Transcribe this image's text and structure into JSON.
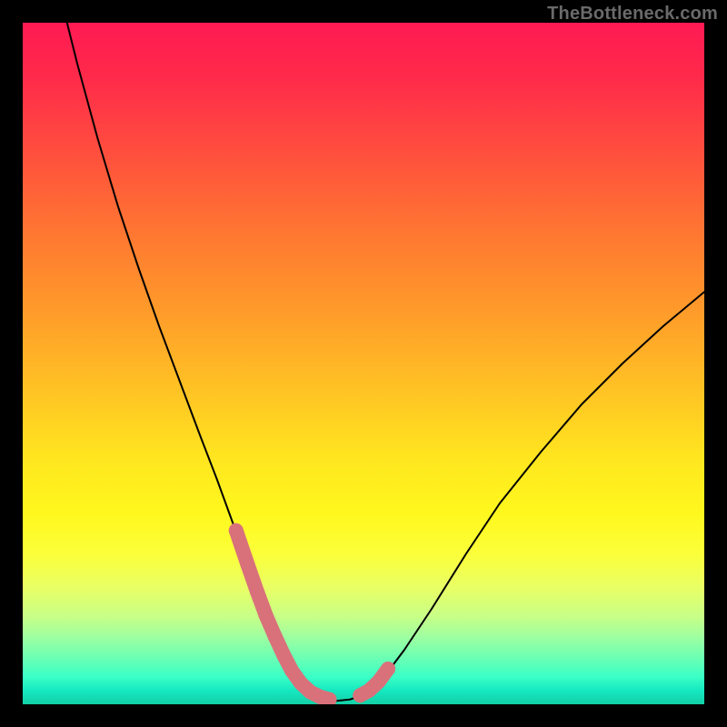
{
  "watermark": {
    "text": "TheBottleneck.com"
  },
  "chart_data": {
    "type": "line",
    "title": "",
    "xlabel": "",
    "ylabel": "",
    "xlim": [
      0,
      100
    ],
    "ylim": [
      0,
      100
    ],
    "grid": false,
    "legend": false,
    "annotations": [],
    "series": [
      {
        "name": "left-curve",
        "color": "#000000",
        "x": [
          6.5,
          8,
          11,
          14,
          17,
          20,
          23,
          26,
          28.5,
          30.5,
          32.5,
          34,
          35.5,
          37,
          38.3,
          39.5,
          40.5,
          41.5,
          42.5
        ],
        "y": [
          100,
          94,
          83,
          73,
          64,
          55.5,
          47.5,
          39.5,
          33,
          27.5,
          22,
          17.5,
          13.5,
          10,
          7,
          4.5,
          2.8,
          1.6,
          1.0
        ]
      },
      {
        "name": "valley-floor",
        "color": "#000000",
        "x": [
          42.5,
          44,
          46,
          48,
          49.5
        ],
        "y": [
          1.0,
          0.6,
          0.5,
          0.7,
          1.2
        ]
      },
      {
        "name": "right-curve",
        "color": "#000000",
        "x": [
          49.5,
          51,
          53,
          56,
          60,
          65,
          70,
          76,
          82,
          88,
          94,
          100
        ],
        "y": [
          1.2,
          2.1,
          4.0,
          8.0,
          14,
          22,
          29.5,
          37,
          44,
          50,
          55.5,
          60.5
        ]
      },
      {
        "name": "left-highlight-dots",
        "color": "#d9717b",
        "marker": "round",
        "x": [
          31.3,
          33.0,
          34.4,
          35.7,
          37.0,
          38.3,
          39.5,
          40.8,
          42.2,
          43.6,
          45.0
        ],
        "y": [
          25.5,
          20.5,
          16.5,
          13.0,
          10.0,
          7.2,
          4.9,
          3.1,
          1.8,
          1.1,
          0.7
        ]
      },
      {
        "name": "right-highlight-dots",
        "color": "#d9717b",
        "marker": "round",
        "x": [
          49.5,
          50.8,
          52.2,
          53.6
        ],
        "y": [
          1.3,
          2.0,
          3.3,
          5.2
        ]
      }
    ],
    "gradient_bands": [
      {
        "position": 0,
        "color": "#ff1a53"
      },
      {
        "position": 50,
        "color": "#ffc324"
      },
      {
        "position": 75,
        "color": "#fff81e"
      },
      {
        "position": 92,
        "color": "#7effae"
      },
      {
        "position": 100,
        "color": "#14cfa6"
      }
    ]
  }
}
